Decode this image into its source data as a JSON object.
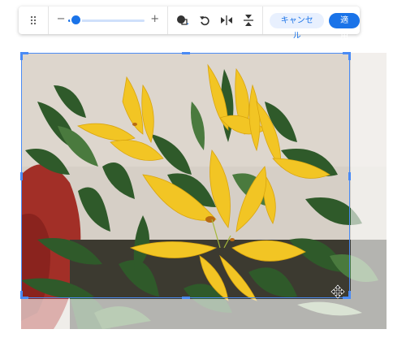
{
  "toolbar": {
    "drag_handle_icon": "drag-handle-icon",
    "zoom": {
      "minus_label": "−",
      "plus_label": "+",
      "value_fraction": 0.1
    },
    "tools": [
      {
        "name": "mask-shape-button",
        "icon": "mask-shape-icon"
      },
      {
        "name": "rotate-button",
        "icon": "rotate-ccw-icon"
      },
      {
        "name": "flip-horizontal-button",
        "icon": "flip-horizontal-icon"
      },
      {
        "name": "flip-vertical-button",
        "icon": "flip-vertical-icon"
      }
    ],
    "cancel_label": "キャンセル",
    "apply_label": "適用"
  },
  "canvas": {
    "image": "yellow-lily-bouquet-photo",
    "move_icon": "move-arrows-icon"
  },
  "colors": {
    "accent": "#1a73e8",
    "cancel_bg": "#e8f0fe",
    "crop_border": "#4a8bf5"
  }
}
